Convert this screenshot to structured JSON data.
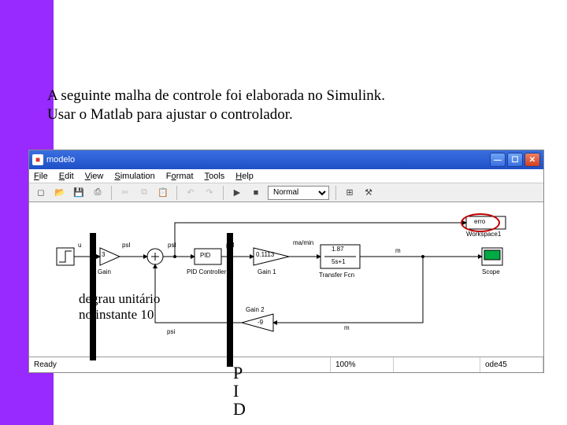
{
  "intro": {
    "line1": "A seguinte malha de controle foi elaborada no Simulink.",
    "line2": "Usar o Matlab para ajustar o controlador."
  },
  "window": {
    "title": "modelo"
  },
  "menu": {
    "file": "File",
    "edit": "Edit",
    "view": "View",
    "simulation": "Simulation",
    "format": "Format",
    "tools": "Tools",
    "help": "Help"
  },
  "toolbar": {
    "mode": "Normal"
  },
  "blocks": {
    "erro_label": "erro",
    "workspace1": "Workspace1",
    "scope": "Scope",
    "step": "u",
    "gain_label": "Gain",
    "gain_val": "3",
    "sum_psi": "psI",
    "pid": "PID",
    "pid_label": "PID Controller",
    "gain1_val": "0.1113",
    "gain1_label": "Gain 1",
    "tf_num": "1.87",
    "tf_den": "5s+1",
    "tf_label": "Transfer Fcn",
    "tf_unit": "ma/min",
    "gain2_val": "-9",
    "gain2_label": "Gain 2",
    "gain2_unit": "psi",
    "m_label": "m"
  },
  "status": {
    "ready": "Ready",
    "zoom": "100%",
    "solver": "ode45"
  },
  "annotations": {
    "step": "degrau unitário\nno instante 10",
    "pid_letters": "P\nI\nD"
  }
}
